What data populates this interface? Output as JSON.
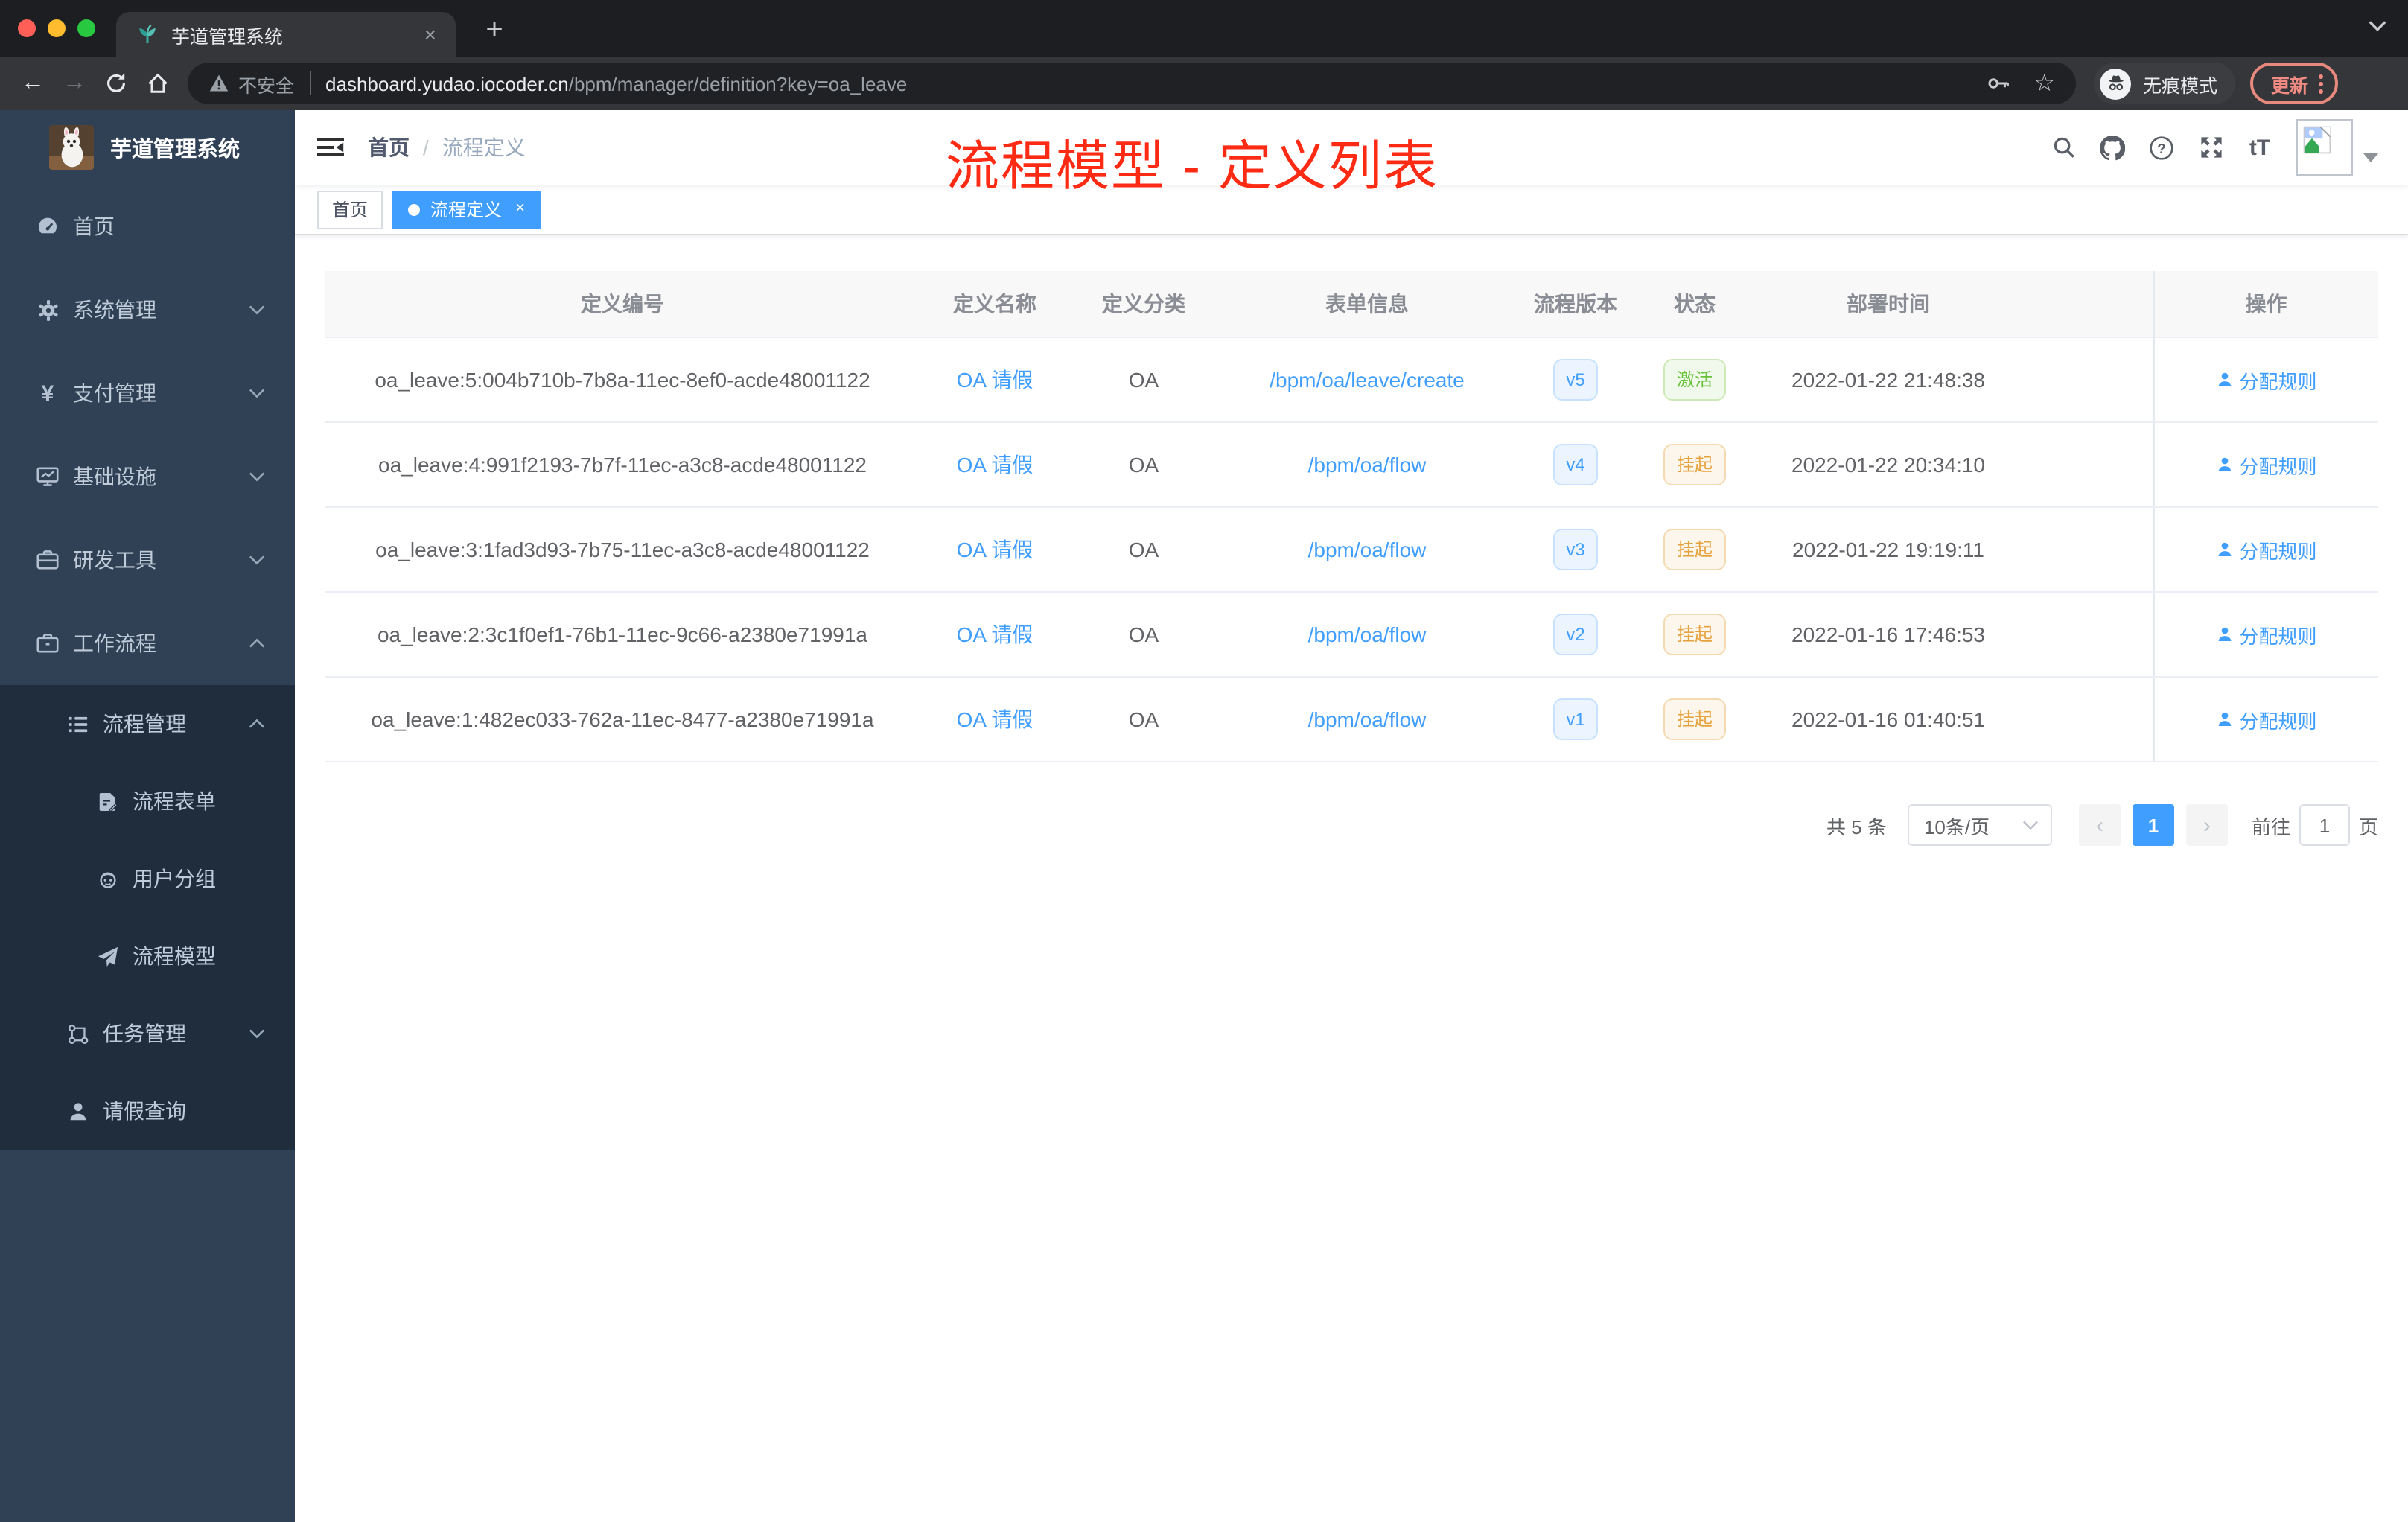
{
  "browser": {
    "tab": {
      "title": "芋道管理系统",
      "close": "×",
      "new_tab": "+"
    },
    "address": {
      "warning_label": "不安全",
      "host": "dashboard.yudao.iocoder.cn",
      "path": "/bpm/manager/definition?key=oa_leave"
    },
    "incognito_label": "无痕模式",
    "update_label": "更新"
  },
  "icons": {
    "back": "←",
    "forward": "→",
    "star": "☆",
    "yen": "¥",
    "text_size": "tT",
    "question_mark": "?"
  },
  "sidebar": {
    "title": "芋道管理系统",
    "items": [
      {
        "label": "首页"
      },
      {
        "label": "系统管理"
      },
      {
        "label": "支付管理"
      },
      {
        "label": "基础设施"
      },
      {
        "label": "研发工具"
      },
      {
        "label": "工作流程"
      },
      {
        "label": "流程管理"
      },
      {
        "label": "流程表单"
      },
      {
        "label": "用户分组"
      },
      {
        "label": "流程模型"
      },
      {
        "label": "任务管理"
      },
      {
        "label": "请假查询"
      }
    ]
  },
  "header": {
    "breadcrumb": {
      "home": "首页",
      "separator": "/",
      "current": "流程定义"
    },
    "annotation_title": "流程模型 - 定义列表"
  },
  "tags_view": {
    "close": "×",
    "tags": [
      {
        "label": "首页",
        "active": false
      },
      {
        "label": "流程定义",
        "active": true
      }
    ]
  },
  "table": {
    "columns": [
      "定义编号",
      "定义名称",
      "定义分类",
      "表单信息",
      "流程版本",
      "状态",
      "部署时间",
      "操作"
    ],
    "rows": [
      {
        "id": "oa_leave:5:004b710b-7b8a-11ec-8ef0-acde48001122",
        "name": "OA 请假",
        "category": "OA",
        "form": "/bpm/oa/leave/create",
        "version": "v5",
        "status": "激活",
        "status_type": "success",
        "deployed_at": "2022-01-22 21:48:38",
        "action": "分配规则"
      },
      {
        "id": "oa_leave:4:991f2193-7b7f-11ec-a3c8-acde48001122",
        "name": "OA 请假",
        "category": "OA",
        "form": "/bpm/oa/flow",
        "version": "v4",
        "status": "挂起",
        "status_type": "warning",
        "deployed_at": "2022-01-22 20:34:10",
        "action": "分配规则"
      },
      {
        "id": "oa_leave:3:1fad3d93-7b75-11ec-a3c8-acde48001122",
        "name": "OA 请假",
        "category": "OA",
        "form": "/bpm/oa/flow",
        "version": "v3",
        "status": "挂起",
        "status_type": "warning",
        "deployed_at": "2022-01-22 19:19:11",
        "action": "分配规则"
      },
      {
        "id": "oa_leave:2:3c1f0ef1-76b1-11ec-9c66-a2380e71991a",
        "name": "OA 请假",
        "category": "OA",
        "form": "/bpm/oa/flow",
        "version": "v2",
        "status": "挂起",
        "status_type": "warning",
        "deployed_at": "2022-01-16 17:46:53",
        "action": "分配规则"
      },
      {
        "id": "oa_leave:1:482ec033-762a-11ec-8477-a2380e71991a",
        "name": "OA 请假",
        "category": "OA",
        "form": "/bpm/oa/flow",
        "version": "v1",
        "status": "挂起",
        "status_type": "warning",
        "deployed_at": "2022-01-16 01:40:51",
        "action": "分配规则"
      }
    ]
  },
  "pagination": {
    "total": "共 5 条",
    "page_size": "10条/页",
    "prev": "‹",
    "page": "1",
    "next": "›",
    "goto_label": "前往",
    "goto_value": "1",
    "unit": "页"
  },
  "colors": {
    "accent": "#409eff",
    "sidebar_bg": "#304156",
    "submenu_bg": "#1f2d3d",
    "annotation_red": "#fd2b14",
    "status_active_text": "#67c23a",
    "status_suspended_text": "#e6a23c"
  }
}
